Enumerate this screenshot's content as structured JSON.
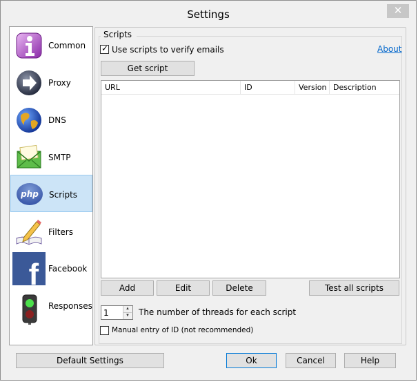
{
  "window": {
    "title": "Settings",
    "close_glyph": "✕"
  },
  "sidebar": {
    "items": [
      {
        "label": "Common",
        "icon": "info-icon"
      },
      {
        "label": "Proxy",
        "icon": "proxy-arrow-icon"
      },
      {
        "label": "DNS",
        "icon": "globe-icon"
      },
      {
        "label": "SMTP",
        "icon": "mail-icon"
      },
      {
        "label": "Scripts",
        "icon": "php-icon",
        "selected": true,
        "icon_text": "php"
      },
      {
        "label": "Filters",
        "icon": "pencil-book-icon"
      },
      {
        "label": "Facebook",
        "icon": "facebook-icon",
        "icon_text": "f"
      },
      {
        "label": "Responses",
        "icon": "traffic-light-icon"
      }
    ]
  },
  "scripts": {
    "group_title": "Scripts",
    "use_scripts_label": "Use scripts to verify emails",
    "use_scripts_checked": true,
    "about_label": "About",
    "get_script_label": "Get script",
    "table": {
      "columns": [
        "URL",
        "ID",
        "Version",
        "Description"
      ],
      "rows": []
    },
    "add_label": "Add",
    "edit_label": "Edit",
    "delete_label": "Delete",
    "test_all_label": "Test all scripts",
    "threads_value": "1",
    "threads_label": "The number of threads for each script",
    "manual_id_label": "Manual entry of ID (not recommended)",
    "manual_id_checked": false
  },
  "footer": {
    "default_settings_label": "Default Settings",
    "ok_label": "Ok",
    "cancel_label": "Cancel",
    "help_label": "Help"
  },
  "colors": {
    "selected_bg": "#cce4f7",
    "link": "#0066cc",
    "accent": "#0078d7"
  }
}
